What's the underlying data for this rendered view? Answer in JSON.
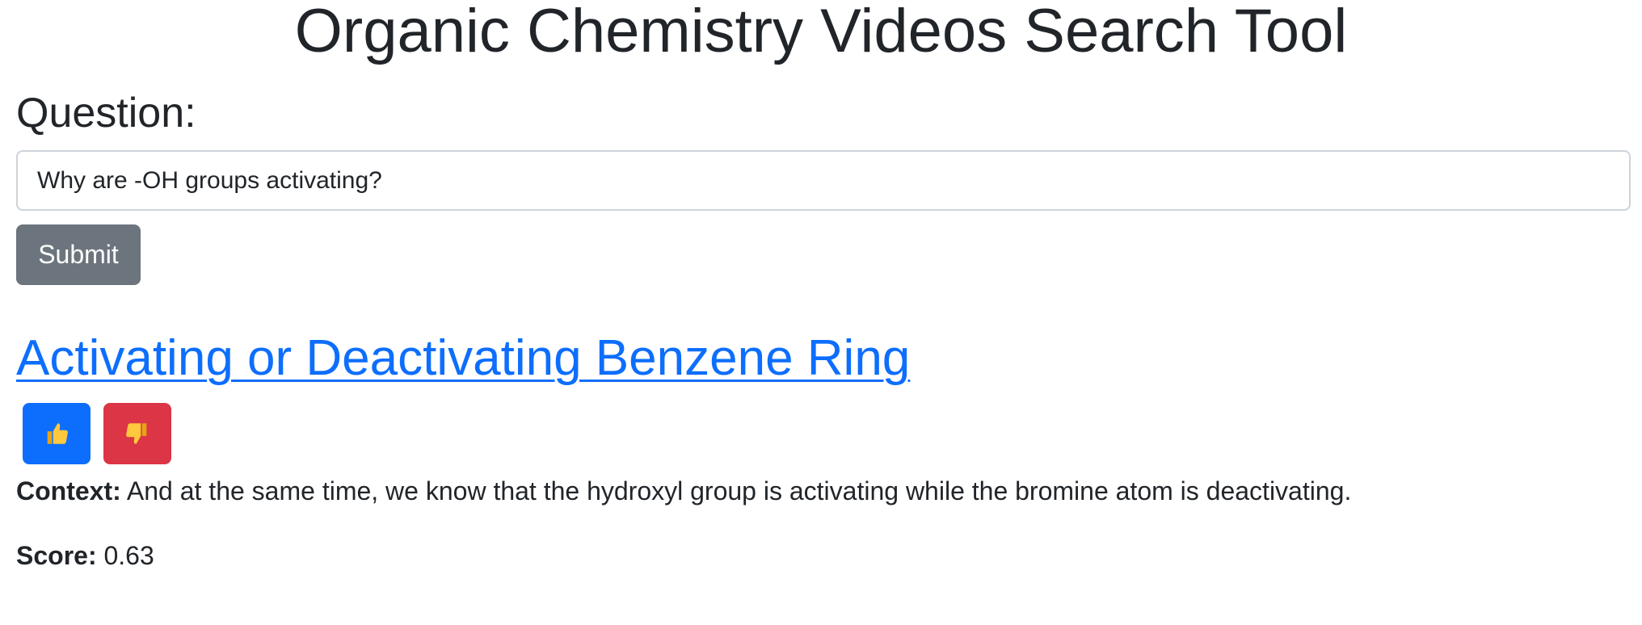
{
  "header": {
    "title": "Organic Chemistry Videos Search Tool"
  },
  "search": {
    "label": "Question:",
    "value": "Why are -OH groups activating?",
    "submit_label": "Submit"
  },
  "result": {
    "title": "Activating or Deactivating Benzene Ring",
    "thumbs_up_icon": "thumbs-up-icon",
    "thumbs_down_icon": "thumbs-down-icon",
    "context_label": "Context:",
    "context_text": "And at the same time, we know that the hydroxyl group is activating while the bromine atom is deactivating.",
    "score_label": "Score:",
    "score_value": "0.63"
  },
  "colors": {
    "link": "#0d6efd",
    "submit_button": "#6c757d",
    "upvote_button": "#0d6efd",
    "downvote_button": "#dc3545",
    "text": "#212529"
  }
}
